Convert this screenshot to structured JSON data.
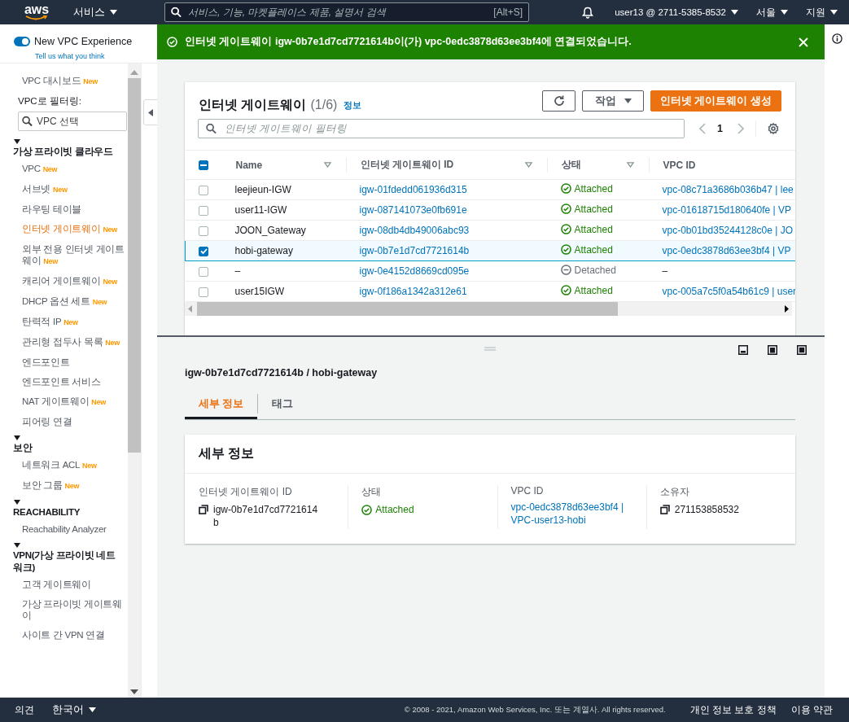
{
  "top_nav": {
    "logo": "aws",
    "services": "서비스",
    "search": {
      "placeholder": "서비스, 기능, 마켓플레이스 제품, 설명서 검색",
      "shortcut": "[Alt+S]"
    },
    "account": "user13 @ 2711-5385-8532",
    "region": "서울",
    "support": "지원"
  },
  "sidebar": {
    "toggle": {
      "label": "New VPC Experience",
      "on": true,
      "link": "Tell us what you think"
    },
    "dashboard": {
      "text": "VPC 대시보드",
      "badge": "New",
      "selected": false
    },
    "filter_label": "VPC로 필터링:",
    "filter": {
      "placeholder": "VPC 선택"
    },
    "sections": [
      {
        "title": "가상 프라이빗 클라우드",
        "expanded": true,
        "items": [
          {
            "text": "VPC",
            "badge": "New",
            "selected": false
          },
          {
            "text": "서브넷",
            "badge": "New",
            "selected": false
          },
          {
            "text": "라우팅 테이블",
            "selected": false
          },
          {
            "text": "인터넷 게이트웨이",
            "badge": "New",
            "selected": true
          },
          {
            "text": "외부 전용 인터넷 게이트웨이",
            "badge": "New",
            "selected": false
          },
          {
            "text": "캐리어 게이트웨이",
            "badge": "New",
            "selected": false
          },
          {
            "text": "DHCP 옵션 세트",
            "badge": "New",
            "selected": false
          },
          {
            "text": "탄력적 IP",
            "badge": "New",
            "selected": false
          },
          {
            "text": "관리형 접두사 목록",
            "badge": "New",
            "selected": false
          },
          {
            "text": "엔드포인트",
            "selected": false
          },
          {
            "text": "엔드포인트 서비스",
            "selected": false
          },
          {
            "text": "NAT 게이트웨이",
            "badge": "New",
            "selected": false
          },
          {
            "text": "피어링 연결",
            "selected": false
          }
        ]
      },
      {
        "title": "보안",
        "expanded": true,
        "items": [
          {
            "text": "네트워크 ACL",
            "badge": "New",
            "selected": false
          },
          {
            "text": "보안 그룹",
            "badge": "New",
            "selected": false
          }
        ]
      },
      {
        "title": "REACHABILITY",
        "expanded": true,
        "items": [
          {
            "text": "Reachability Analyzer",
            "selected": false
          }
        ]
      },
      {
        "title": "VPN(가상 프라이빗 네트워크)",
        "expanded": true,
        "items": [
          {
            "text": "고객 게이트웨이",
            "selected": false
          },
          {
            "text": "가상 프라이빗 게이트웨이",
            "selected": false
          },
          {
            "text": "사이트 간 VPN 연결",
            "selected": false
          }
        ]
      }
    ]
  },
  "flash": {
    "kind": "success",
    "message": "인터넷 게이트웨이 igw-0b7e1d7cd7721614b이(가) vpc-0edc3878d63ee3bf4에 연결되었습니다."
  },
  "table": {
    "title": "인터넷 게이트웨이",
    "count": "(1/6)",
    "info": "정보",
    "actions": "작업",
    "create": "인터넷 게이트웨이 생성",
    "filter_placeholder": "인터넷 게이트웨이 필터링",
    "page": "1",
    "indeterminate": true,
    "columns": [
      "Name",
      "인터넷 게이트웨이 ID",
      "상태",
      "VPC ID"
    ],
    "rows": [
      {
        "name": "leejieun-IGW",
        "id": "igw-01fdedd061936d315",
        "attached": true,
        "status": "Attached",
        "vpc": "vpc-08c71a3686b036b47 | lee",
        "selected": false
      },
      {
        "name": "user11-IGW",
        "id": "igw-087141073e0fb691e",
        "attached": true,
        "status": "Attached",
        "vpc": "vpc-01618715d180640fe | VP",
        "selected": false
      },
      {
        "name": "JOON_Gateway",
        "id": "igw-08db4db49006abc93",
        "attached": true,
        "status": "Attached",
        "vpc": "vpc-0b01bd35244128c0e | JO",
        "selected": false
      },
      {
        "name": "hobi-gateway",
        "id": "igw-0b7e1d7cd7721614b",
        "attached": true,
        "status": "Attached",
        "vpc": "vpc-0edc3878d63ee3bf4 | VP",
        "selected": true
      },
      {
        "name": "–",
        "id": "igw-0e4152d8669cd095e",
        "attached": false,
        "status": "Detached",
        "vpc": "–",
        "selected": false
      },
      {
        "name": "user15IGW",
        "id": "igw-0f186a1342a312e61",
        "attached": true,
        "status": "Attached",
        "vpc": "vpc-005a7c5f0a54b61c9 | user",
        "selected": false
      }
    ]
  },
  "details": {
    "heading": "igw-0b7e1d7cd7721614b / hobi-gateway",
    "tabs": [
      {
        "label": "세부 정보",
        "selected": true
      },
      {
        "label": "태그",
        "selected": false
      }
    ],
    "card_title": "세부 정보",
    "fields": [
      {
        "label": "인터넷 게이트웨이 ID",
        "kind": "copy",
        "value": "igw-0b7e1d7cd7721614b"
      },
      {
        "label": "상태",
        "kind": "status",
        "value": "Attached"
      },
      {
        "label": "VPC ID",
        "kind": "link",
        "value": "vpc-0edc3878d63ee3bf4 | VPC-user13-hobi"
      },
      {
        "label": "소유자",
        "kind": "copy",
        "value": "271153858532"
      }
    ]
  },
  "footer": {
    "feedback": "의견",
    "language": "한국어",
    "copyright": "© 2008 - 2021, Amazon Web Services, Inc. 또는 계열사. All rights reserved.",
    "privacy": "개인 정보 보호 정책",
    "terms": "이용 약관"
  }
}
